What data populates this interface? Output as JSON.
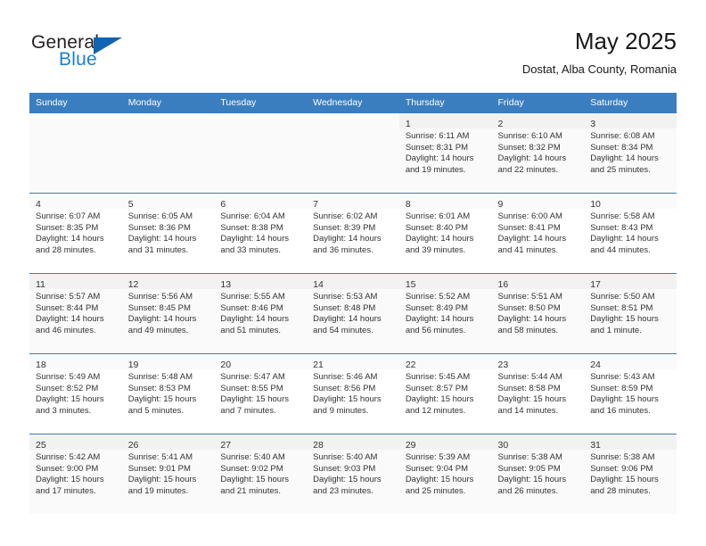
{
  "brand": {
    "name_part1": "General",
    "name_part2": "Blue",
    "accent_color": "#1c7fd4",
    "triangle_color": "#1263b0"
  },
  "header": {
    "title": "May 2025",
    "subtitle": "Dostat, Alba County, Romania"
  },
  "calendar": {
    "header_bg": "#3a7ec0",
    "weekdays": [
      "Sunday",
      "Monday",
      "Tuesday",
      "Wednesday",
      "Thursday",
      "Friday",
      "Saturday"
    ],
    "leading_blanks": 4,
    "weeks": [
      [
        null,
        null,
        null,
        null,
        {
          "day": "1",
          "sunrise": "Sunrise: 6:11 AM",
          "sunset": "Sunset: 8:31 PM",
          "daylight_line1": "Daylight: 14 hours",
          "daylight_line2": "and 19 minutes."
        },
        {
          "day": "2",
          "sunrise": "Sunrise: 6:10 AM",
          "sunset": "Sunset: 8:32 PM",
          "daylight_line1": "Daylight: 14 hours",
          "daylight_line2": "and 22 minutes."
        },
        {
          "day": "3",
          "sunrise": "Sunrise: 6:08 AM",
          "sunset": "Sunset: 8:34 PM",
          "daylight_line1": "Daylight: 14 hours",
          "daylight_line2": "and 25 minutes."
        }
      ],
      [
        {
          "day": "4",
          "sunrise": "Sunrise: 6:07 AM",
          "sunset": "Sunset: 8:35 PM",
          "daylight_line1": "Daylight: 14 hours",
          "daylight_line2": "and 28 minutes."
        },
        {
          "day": "5",
          "sunrise": "Sunrise: 6:05 AM",
          "sunset": "Sunset: 8:36 PM",
          "daylight_line1": "Daylight: 14 hours",
          "daylight_line2": "and 31 minutes."
        },
        {
          "day": "6",
          "sunrise": "Sunrise: 6:04 AM",
          "sunset": "Sunset: 8:38 PM",
          "daylight_line1": "Daylight: 14 hours",
          "daylight_line2": "and 33 minutes."
        },
        {
          "day": "7",
          "sunrise": "Sunrise: 6:02 AM",
          "sunset": "Sunset: 8:39 PM",
          "daylight_line1": "Daylight: 14 hours",
          "daylight_line2": "and 36 minutes."
        },
        {
          "day": "8",
          "sunrise": "Sunrise: 6:01 AM",
          "sunset": "Sunset: 8:40 PM",
          "daylight_line1": "Daylight: 14 hours",
          "daylight_line2": "and 39 minutes."
        },
        {
          "day": "9",
          "sunrise": "Sunrise: 6:00 AM",
          "sunset": "Sunset: 8:41 PM",
          "daylight_line1": "Daylight: 14 hours",
          "daylight_line2": "and 41 minutes."
        },
        {
          "day": "10",
          "sunrise": "Sunrise: 5:58 AM",
          "sunset": "Sunset: 8:43 PM",
          "daylight_line1": "Daylight: 14 hours",
          "daylight_line2": "and 44 minutes."
        }
      ],
      [
        {
          "day": "11",
          "sunrise": "Sunrise: 5:57 AM",
          "sunset": "Sunset: 8:44 PM",
          "daylight_line1": "Daylight: 14 hours",
          "daylight_line2": "and 46 minutes."
        },
        {
          "day": "12",
          "sunrise": "Sunrise: 5:56 AM",
          "sunset": "Sunset: 8:45 PM",
          "daylight_line1": "Daylight: 14 hours",
          "daylight_line2": "and 49 minutes."
        },
        {
          "day": "13",
          "sunrise": "Sunrise: 5:55 AM",
          "sunset": "Sunset: 8:46 PM",
          "daylight_line1": "Daylight: 14 hours",
          "daylight_line2": "and 51 minutes."
        },
        {
          "day": "14",
          "sunrise": "Sunrise: 5:53 AM",
          "sunset": "Sunset: 8:48 PM",
          "daylight_line1": "Daylight: 14 hours",
          "daylight_line2": "and 54 minutes."
        },
        {
          "day": "15",
          "sunrise": "Sunrise: 5:52 AM",
          "sunset": "Sunset: 8:49 PM",
          "daylight_line1": "Daylight: 14 hours",
          "daylight_line2": "and 56 minutes."
        },
        {
          "day": "16",
          "sunrise": "Sunrise: 5:51 AM",
          "sunset": "Sunset: 8:50 PM",
          "daylight_line1": "Daylight: 14 hours",
          "daylight_line2": "and 58 minutes."
        },
        {
          "day": "17",
          "sunrise": "Sunrise: 5:50 AM",
          "sunset": "Sunset: 8:51 PM",
          "daylight_line1": "Daylight: 15 hours",
          "daylight_line2": "and 1 minute."
        }
      ],
      [
        {
          "day": "18",
          "sunrise": "Sunrise: 5:49 AM",
          "sunset": "Sunset: 8:52 PM",
          "daylight_line1": "Daylight: 15 hours",
          "daylight_line2": "and 3 minutes."
        },
        {
          "day": "19",
          "sunrise": "Sunrise: 5:48 AM",
          "sunset": "Sunset: 8:53 PM",
          "daylight_line1": "Daylight: 15 hours",
          "daylight_line2": "and 5 minutes."
        },
        {
          "day": "20",
          "sunrise": "Sunrise: 5:47 AM",
          "sunset": "Sunset: 8:55 PM",
          "daylight_line1": "Daylight: 15 hours",
          "daylight_line2": "and 7 minutes."
        },
        {
          "day": "21",
          "sunrise": "Sunrise: 5:46 AM",
          "sunset": "Sunset: 8:56 PM",
          "daylight_line1": "Daylight: 15 hours",
          "daylight_line2": "and 9 minutes."
        },
        {
          "day": "22",
          "sunrise": "Sunrise: 5:45 AM",
          "sunset": "Sunset: 8:57 PM",
          "daylight_line1": "Daylight: 15 hours",
          "daylight_line2": "and 12 minutes."
        },
        {
          "day": "23",
          "sunrise": "Sunrise: 5:44 AM",
          "sunset": "Sunset: 8:58 PM",
          "daylight_line1": "Daylight: 15 hours",
          "daylight_line2": "and 14 minutes."
        },
        {
          "day": "24",
          "sunrise": "Sunrise: 5:43 AM",
          "sunset": "Sunset: 8:59 PM",
          "daylight_line1": "Daylight: 15 hours",
          "daylight_line2": "and 16 minutes."
        }
      ],
      [
        {
          "day": "25",
          "sunrise": "Sunrise: 5:42 AM",
          "sunset": "Sunset: 9:00 PM",
          "daylight_line1": "Daylight: 15 hours",
          "daylight_line2": "and 17 minutes."
        },
        {
          "day": "26",
          "sunrise": "Sunrise: 5:41 AM",
          "sunset": "Sunset: 9:01 PM",
          "daylight_line1": "Daylight: 15 hours",
          "daylight_line2": "and 19 minutes."
        },
        {
          "day": "27",
          "sunrise": "Sunrise: 5:40 AM",
          "sunset": "Sunset: 9:02 PM",
          "daylight_line1": "Daylight: 15 hours",
          "daylight_line2": "and 21 minutes."
        },
        {
          "day": "28",
          "sunrise": "Sunrise: 5:40 AM",
          "sunset": "Sunset: 9:03 PM",
          "daylight_line1": "Daylight: 15 hours",
          "daylight_line2": "and 23 minutes."
        },
        {
          "day": "29",
          "sunrise": "Sunrise: 5:39 AM",
          "sunset": "Sunset: 9:04 PM",
          "daylight_line1": "Daylight: 15 hours",
          "daylight_line2": "and 25 minutes."
        },
        {
          "day": "30",
          "sunrise": "Sunrise: 5:38 AM",
          "sunset": "Sunset: 9:05 PM",
          "daylight_line1": "Daylight: 15 hours",
          "daylight_line2": "and 26 minutes."
        },
        {
          "day": "31",
          "sunrise": "Sunrise: 5:38 AM",
          "sunset": "Sunset: 9:06 PM",
          "daylight_line1": "Daylight: 15 hours",
          "daylight_line2": "and 28 minutes."
        }
      ]
    ]
  }
}
